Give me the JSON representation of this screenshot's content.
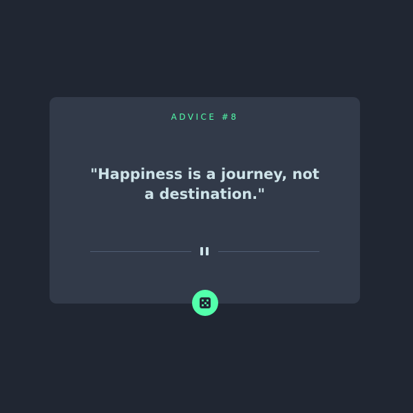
{
  "card": {
    "advice_label": "ADVICE #8",
    "quote": "\"Happiness is a journey, not a destination.\""
  },
  "divider": {
    "icon": "pause-icon"
  },
  "generate_button": {
    "icon": "dice-icon"
  },
  "colors": {
    "background": "#202632",
    "card": "#323a49",
    "accent": "#53ffab",
    "text": "#cee3e9",
    "divider": "#4f5d74"
  }
}
